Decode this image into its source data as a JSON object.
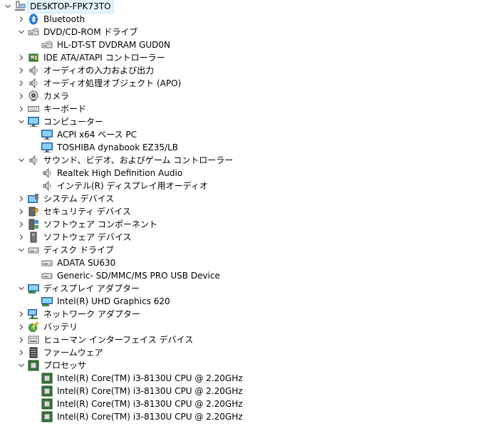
{
  "tree": [
    {
      "label": "DESKTOP-FPK73TO",
      "icon": "computer-tree-icon",
      "level": 0,
      "expanded": true,
      "root": true
    },
    {
      "label": "Bluetooth",
      "icon": "bluetooth-icon",
      "level": 1,
      "expanded": false
    },
    {
      "label": "DVD/CD-ROM ドライブ",
      "icon": "dvd-drive-icon",
      "level": 1,
      "expanded": true
    },
    {
      "label": "HL-DT-ST DVDRAM GUD0N",
      "icon": "dvd-drive-icon",
      "level": 2
    },
    {
      "label": "IDE ATA/ATAPI コントローラー",
      "icon": "ide-controller-icon",
      "level": 1,
      "expanded": false
    },
    {
      "label": "オーディオの入力および出力",
      "icon": "speaker-icon",
      "level": 1,
      "expanded": false
    },
    {
      "label": "オーディオ処理オブジェクト (APO)",
      "icon": "speaker-icon",
      "level": 1,
      "expanded": false
    },
    {
      "label": "カメラ",
      "icon": "camera-icon",
      "level": 1,
      "expanded": false
    },
    {
      "label": "キーボード",
      "icon": "keyboard-icon",
      "level": 1,
      "expanded": false
    },
    {
      "label": "コンピューター",
      "icon": "monitor-icon",
      "level": 1,
      "expanded": true
    },
    {
      "label": "ACPI x64 ベース PC",
      "icon": "monitor-icon",
      "level": 2
    },
    {
      "label": "TOSHIBA dynabook EZ35/LB",
      "icon": "monitor-icon",
      "level": 2
    },
    {
      "label": "サウンド、ビデオ、およびゲーム コントローラー",
      "icon": "speaker-icon",
      "level": 1,
      "expanded": true
    },
    {
      "label": "Realtek High Definition Audio",
      "icon": "speaker-icon",
      "level": 2
    },
    {
      "label": "インテル(R) ディスプレイ用オーディオ",
      "icon": "speaker-icon",
      "level": 2
    },
    {
      "label": "システム デバイス",
      "icon": "system-devices-icon",
      "level": 1,
      "expanded": false
    },
    {
      "label": "セキュリティ デバイス",
      "icon": "security-key-icon",
      "level": 1,
      "expanded": false
    },
    {
      "label": "ソフトウェア コンポーネント",
      "icon": "software-component-icon",
      "level": 1,
      "expanded": false
    },
    {
      "label": "ソフトウェア デバイス",
      "icon": "software-device-icon",
      "level": 1,
      "expanded": false
    },
    {
      "label": "ディスク ドライブ",
      "icon": "disk-drive-icon",
      "level": 1,
      "expanded": true
    },
    {
      "label": "ADATA SU630",
      "icon": "disk-drive-icon",
      "level": 2
    },
    {
      "label": "Generic- SD/MMC/MS PRO USB Device",
      "icon": "disk-drive-icon",
      "level": 2
    },
    {
      "label": "ディスプレイ アダプター",
      "icon": "display-adapter-icon",
      "level": 1,
      "expanded": true
    },
    {
      "label": "Intel(R) UHD Graphics 620",
      "icon": "display-adapter-icon",
      "level": 2
    },
    {
      "label": "ネットワーク アダプター",
      "icon": "network-adapter-icon",
      "level": 1,
      "expanded": false
    },
    {
      "label": "バッテリ",
      "icon": "battery-icon",
      "level": 1,
      "expanded": false
    },
    {
      "label": "ヒューマン インターフェイス デバイス",
      "icon": "hid-icon",
      "level": 1,
      "expanded": false
    },
    {
      "label": "ファームウェア",
      "icon": "firmware-icon",
      "level": 1,
      "expanded": false
    },
    {
      "label": "プロセッサ",
      "icon": "processor-icon",
      "level": 1,
      "expanded": true
    },
    {
      "label": "Intel(R) Core(TM) i3-8130U CPU @ 2.20GHz",
      "icon": "processor-icon",
      "level": 2
    },
    {
      "label": "Intel(R) Core(TM) i3-8130U CPU @ 2.20GHz",
      "icon": "processor-icon",
      "level": 2
    },
    {
      "label": "Intel(R) Core(TM) i3-8130U CPU @ 2.20GHz",
      "icon": "processor-icon",
      "level": 2
    },
    {
      "label": "Intel(R) Core(TM) i3-8130U CPU @ 2.20GHz",
      "icon": "processor-icon",
      "level": 2
    }
  ]
}
